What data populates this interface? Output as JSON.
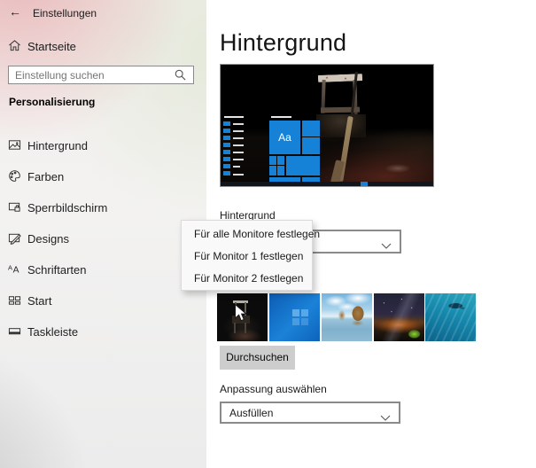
{
  "colors": {
    "accent": "#0078d7",
    "tile_blue": "#1581d7",
    "button_bg": "#cccccc",
    "menu_bg": "#f9f9f9"
  },
  "header": {
    "back_icon": "←",
    "title": "Einstellungen"
  },
  "sidebar": {
    "home": {
      "icon": "home-icon",
      "label": "Startseite"
    },
    "search": {
      "placeholder": "Einstellung suchen",
      "icon": "search-icon"
    },
    "section_heading": "Personalisierung",
    "items": [
      {
        "icon": "image-icon",
        "label": "Hintergrund"
      },
      {
        "icon": "palette-icon",
        "label": "Farben"
      },
      {
        "icon": "lock-screen-icon",
        "label": "Sperrbildschirm"
      },
      {
        "icon": "themes-icon",
        "label": "Designs"
      },
      {
        "icon": "fonts-icon",
        "label": "Schriftarten"
      },
      {
        "icon": "start-tiles-icon",
        "label": "Start"
      },
      {
        "icon": "taskbar-icon",
        "label": "Taskleiste"
      }
    ]
  },
  "main": {
    "page_title": "Hintergrund",
    "preview": {
      "start_tile_label": "Aa"
    },
    "background_type": {
      "label": "Hintergrund",
      "chevron_icon": "chevron-down-icon"
    },
    "context_menu": {
      "items": [
        "Für alle Monitore festlegen",
        "Für Monitor 1 festlegen",
        "Für Monitor 2 festlegen"
      ]
    },
    "thumbnails": [
      {
        "name": "dark-chair-photo"
      },
      {
        "name": "windows-default-blue"
      },
      {
        "name": "beach-rocks-photo"
      },
      {
        "name": "night-sky-tent-photo"
      },
      {
        "name": "underwater-photo"
      }
    ],
    "browse_button": "Durchsuchen",
    "fit": {
      "label": "Anpassung auswählen",
      "value": "Ausfüllen",
      "chevron_icon": "chevron-down-icon"
    }
  }
}
